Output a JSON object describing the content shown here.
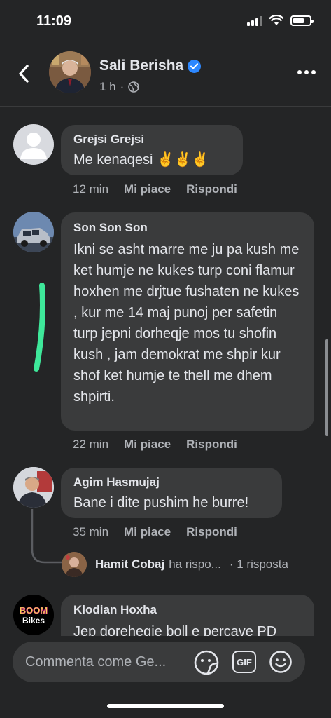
{
  "status": {
    "time": "11:09"
  },
  "header": {
    "name": "Sali Berisha",
    "time": "1 h",
    "separator": "·"
  },
  "comments": [
    {
      "author": "Grejsi Grejsi",
      "text": "Me kenaqesi ✌️✌️✌️",
      "time": "12 min",
      "like": "Mi piace",
      "reply": "Rispondi"
    },
    {
      "author": "Son Son Son",
      "text": "Ikni se asht marre me ju pa kush me ket humje ne kukes turp coni flamur hoxhen me drjtue fushaten ne kukes , kur me 14 maj punoj per safetin turp jepni dorheqje  mos tu shofin kush , jam demokrat me shpir kur shof ket humje te thell me dhem shpirti.",
      "time": "22 min",
      "like": "Mi piace",
      "reply": "Rispondi"
    },
    {
      "author": "Agim Hasmujaj",
      "text": "Bane i dite pushim he burre!",
      "time": "35 min",
      "like": "Mi piace",
      "reply": "Rispondi"
    },
    {
      "author": "Klodian Hoxha",
      "text": "Jep dorehegie boll e percave PD"
    }
  ],
  "reply_summary": {
    "name": "Hamit Cobaj",
    "action": "ha rispo...",
    "count": "· 1 risposta"
  },
  "brand_logo": {
    "top": "BOOM",
    "bottom": "Bikes"
  },
  "input": {
    "placeholder": "Commenta come Ge...",
    "gif_label": "GIF"
  },
  "colors": {
    "background": "#242526",
    "bubble": "#3a3b3c",
    "accent": "#2d88ff",
    "highlight": "#3ee89a"
  }
}
